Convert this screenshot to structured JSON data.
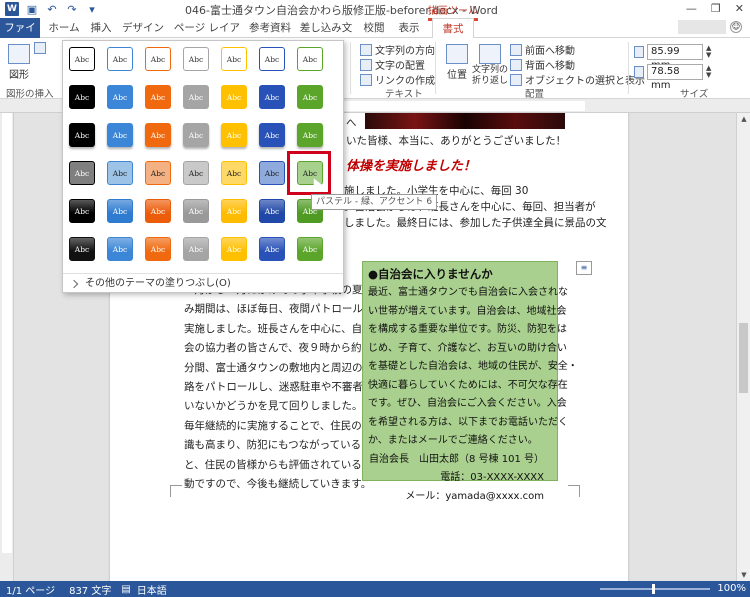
{
  "titlebar": {
    "title": "046-富士通タウン自治会かわら版修正版-beforer.docx - Word",
    "context_label": "描画ツール",
    "minimize": "—",
    "restore": "❐",
    "close": "✕"
  },
  "tabs": {
    "file": "ファイル",
    "items": [
      "ホーム",
      "挿入",
      "デザイン",
      "ページ レイアウト",
      "参考資料",
      "差し込み文書",
      "校閲",
      "表示"
    ],
    "active": "書式"
  },
  "ribbon": {
    "shape_label": "図形",
    "group_insert": "図形の挿入",
    "text_direction": "文字列の方向",
    "text_align": "文字の配置",
    "create_link": "リンクの作成",
    "group_text": "テキスト",
    "position": "位置",
    "wrap_text": "文字列の折り返し",
    "bring_forward": "前面へ移動",
    "send_backward": "背面へ移動",
    "selection_pane": "オブジェクトの選択と表示",
    "group_arrange": "配置",
    "height": "85.99 mm",
    "width": "78.58 mm",
    "group_size": "サイズ"
  },
  "gallery": {
    "swatch_label": "Abc",
    "more_fills": "その他のテーマの塗りつぶし(O)",
    "tooltip": "パステル - 緑、アクセント 6",
    "row_colors": [
      [
        "#ffffff",
        "#ffffff",
        "#ffffff",
        "#ffffff",
        "#ffffff",
        "#ffffff",
        "#ffffff"
      ],
      [
        "#000000",
        "#3b86d6",
        "#f0690f",
        "#a5a5a5",
        "#ffc000",
        "#2852b8",
        "#5aa52a"
      ],
      [
        "#000000",
        "#3b86d6",
        "#f0690f",
        "#a5a5a5",
        "#ffc000",
        "#2852b8",
        "#5aa52a"
      ],
      [
        "#7f7f7f",
        "#9dc3e6",
        "#f4b183",
        "#c9c9c9",
        "#ffd966",
        "#8faadc",
        "#a9d18e"
      ],
      [
        "#000000",
        "#2f7bd0",
        "#ec5d0a",
        "#999999",
        "#ffbb00",
        "#2048a8",
        "#4e9a22"
      ],
      [
        "#111111",
        "#3b86d6",
        "#f0690f",
        "#a5a5a5",
        "#ffc000",
        "#2852b8",
        "#5aa52a"
      ]
    ],
    "outline_colors": [
      "#000000",
      "#3b86d6",
      "#f0690f",
      "#a5a5a5",
      "#ffc000",
      "#2852b8",
      "#5aa52a"
    ]
  },
  "document": {
    "line1": "へ",
    "line2": "いた皆様、本当に、ありがとうございました！",
    "heading": "体操を実施しました！",
    "line3": "施しました。小学生を中心に、毎回 30",
    "line4": "。自治会からは、班長さんを中心に、毎回、担当者が",
    "line5": "しました。最終日には、参加した子供達全員に景品の文",
    "body_lines": [
      "７月から８月にかけての小中学校の夏休",
      "み期間は、ほぼ毎日、夜間パトロールを",
      "実施しました。班長さんを中心に、自治",
      "会の協力者の皆さんで、夜９時から約 30",
      "分間、富士通タウンの敷地内と周辺の道",
      "路をパトロールし、迷惑駐車や不審者が",
      "いないかどうかを見て回りしました。",
      "毎年継続的に実施することで、住民の意",
      "識も高まり、防犯にもつながっている",
      "と、住民の皆様からも評価されている活",
      "動ですので、今後も継続していきます。"
    ],
    "box_title": "●自治会に入りませんか",
    "box_lines": [
      "最近、富士通タウンでも自治会に入会されな",
      "い世帯が増えています。自治会は、地域社会",
      "を構成する重要な単位です。防災、防犯をは",
      "じめ、子育て、介護など、お互いの助け合い",
      "を基礎とした自治会は、地域の住民が、安全・",
      "快適に暮らしていくためには、不可欠な存在",
      "です。ぜひ、自治会にご入会ください。入会",
      "を希望される方は、以下までお電話いただく",
      "か、またはメールでご連絡ください。"
    ],
    "box_contact": [
      "自治会長　山田太郎（8 号棟 101 号）",
      "電話：03-XXXX-XXXX",
      "メール：yamada@xxxx.com"
    ]
  },
  "status": {
    "page": "1/1 ページ",
    "words": "837 文字",
    "language": "日本語",
    "zoom": "100%"
  }
}
